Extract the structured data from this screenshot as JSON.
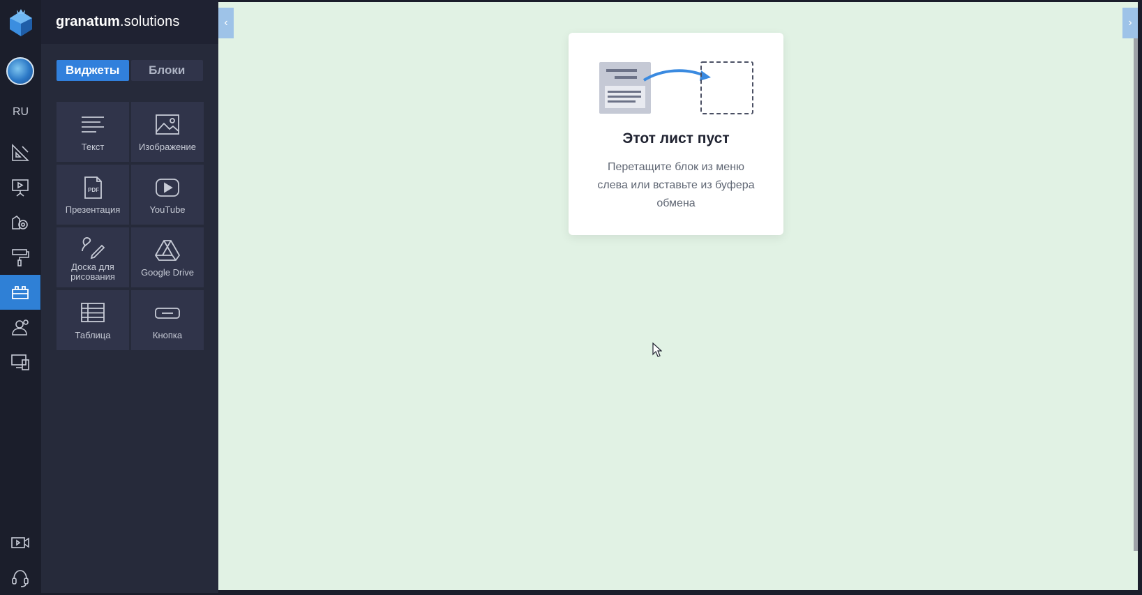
{
  "brand": {
    "name_bold": "granatum",
    "name_rest": ".solutions"
  },
  "rail": {
    "language": "RU",
    "items": [
      {
        "icon": "geometry-tools-icon",
        "active": false
      },
      {
        "icon": "presentation-board-icon",
        "active": false
      },
      {
        "icon": "settings-gear-icon",
        "active": false
      },
      {
        "icon": "paint-roller-icon",
        "active": false
      },
      {
        "icon": "blocks-icon",
        "active": true
      },
      {
        "icon": "users-icon",
        "active": false
      },
      {
        "icon": "devices-icon",
        "active": false
      }
    ],
    "bottom_items": [
      {
        "icon": "video-camera-icon"
      },
      {
        "icon": "support-headset-icon"
      }
    ]
  },
  "panel": {
    "tabs": [
      {
        "label": "Виджеты",
        "active": true
      },
      {
        "label": "Блоки",
        "active": false
      }
    ],
    "widgets": [
      {
        "label": "Текст",
        "icon": "text-lines-icon"
      },
      {
        "label": "Изображение",
        "icon": "image-icon"
      },
      {
        "label": "Презентация",
        "icon": "pdf-file-icon"
      },
      {
        "label": "YouTube",
        "icon": "youtube-play-icon"
      },
      {
        "label": "Доска для рисования",
        "icon": "drawing-pen-icon"
      },
      {
        "label": "Google Drive",
        "icon": "google-drive-icon"
      },
      {
        "label": "Таблица",
        "icon": "table-icon"
      },
      {
        "label": "Кнопка",
        "icon": "button-icon"
      }
    ]
  },
  "empty_state": {
    "title": "Этот лист пуст",
    "description": "Перетащите блок из меню слева или вставьте из буфера обмена",
    "icon": "drag-block-illustration"
  },
  "colors": {
    "accent": "#3180dc",
    "rail_bg": "#1b1e2b",
    "panel_bg": "#262a3a",
    "canvas_bg": "#e1f2e4"
  }
}
